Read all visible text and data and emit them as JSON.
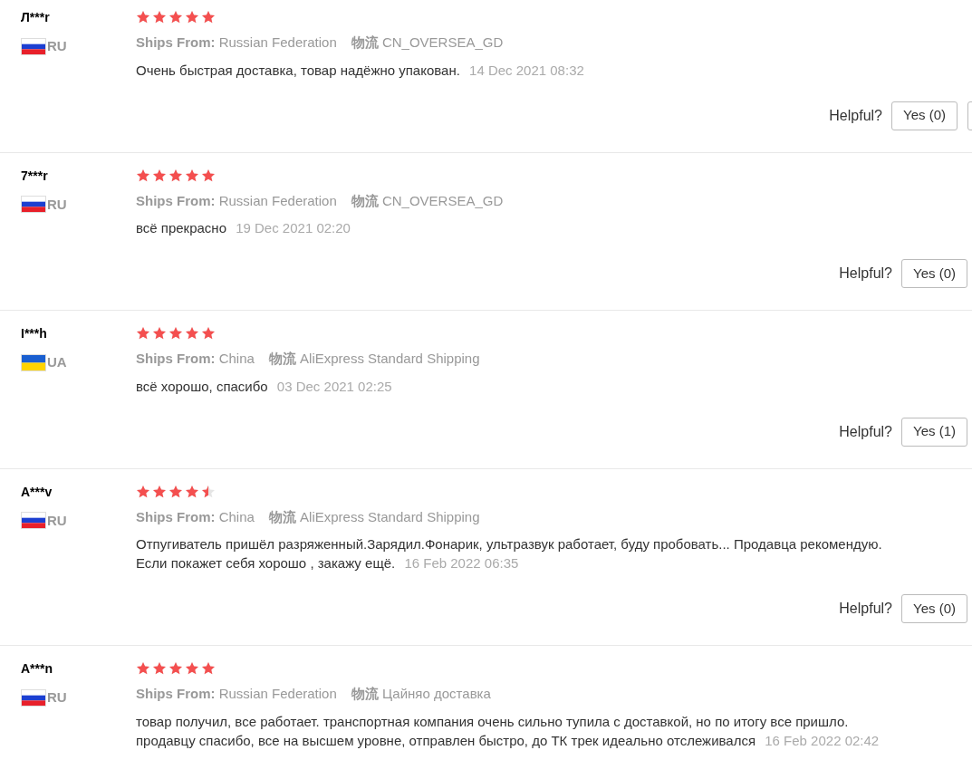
{
  "reviews": [
    {
      "user": "Л***r",
      "kind": "ru",
      "country": "RU",
      "stars": 5,
      "ships_label": "Ships From:",
      "ships_from": "Russian Federation",
      "logistics_label": "物流",
      "logistics": "CN_OVERSEA_GD",
      "text": "Очень быстрая доставка, товар надёжно упакован.",
      "date": "14 Dec 2021 08:32",
      "helpful_label": "Helpful?",
      "yes": "Yes (0)",
      "cut_button": true
    },
    {
      "user": "7***r",
      "kind": "ru",
      "country": "RU",
      "stars": 5,
      "ships_label": "Ships From:",
      "ships_from": "Russian Federation",
      "logistics_label": "物流",
      "logistics": "CN_OVERSEA_GD",
      "text": "всё прекрасно",
      "date": "19 Dec 2021 02:20",
      "helpful_label": "Helpful?",
      "yes": "Yes (0)",
      "cut_button": false
    },
    {
      "user": "I***h",
      "kind": "ua",
      "country": "UA",
      "stars": 5,
      "ships_label": "Ships From:",
      "ships_from": "China",
      "logistics_label": "物流",
      "logistics": "AliExpress Standard Shipping",
      "text": "всё хорошо, спасибо",
      "date": "03 Dec 2021 02:25",
      "helpful_label": "Helpful?",
      "yes": "Yes (1)",
      "cut_button": false
    },
    {
      "user": "A***v",
      "kind": "ru",
      "country": "RU",
      "stars": 4.5,
      "ships_label": "Ships From:",
      "ships_from": "China",
      "logistics_label": "物流",
      "logistics": "AliExpress Standard Shipping",
      "text": "Отпугиватель пришёл разряженный.Зарядил.Фонарик, ультразвук работает, буду пробовать... Продавца рекомендую. Если покажет себя хорошо , закажу ещё.",
      "date": "16 Feb 2022 06:35",
      "helpful_label": "Helpful?",
      "yes": "Yes (0)",
      "cut_button": false
    },
    {
      "user": "A***n",
      "kind": "ru",
      "country": "RU",
      "stars": 5,
      "ships_label": "Ships From:",
      "ships_from": "Russian Federation",
      "logistics_label": "物流",
      "logistics": "Цайняо доставка",
      "text": "товар получил, все работает. транспортная компания очень сильно тупила с доставкой, но по итогу все пришло. продавцу спасибо, все на высшем уровне, отправлен быстро, до ТК трек идеально отслеживался",
      "date": "16 Feb 2022 02:42"
    }
  ]
}
